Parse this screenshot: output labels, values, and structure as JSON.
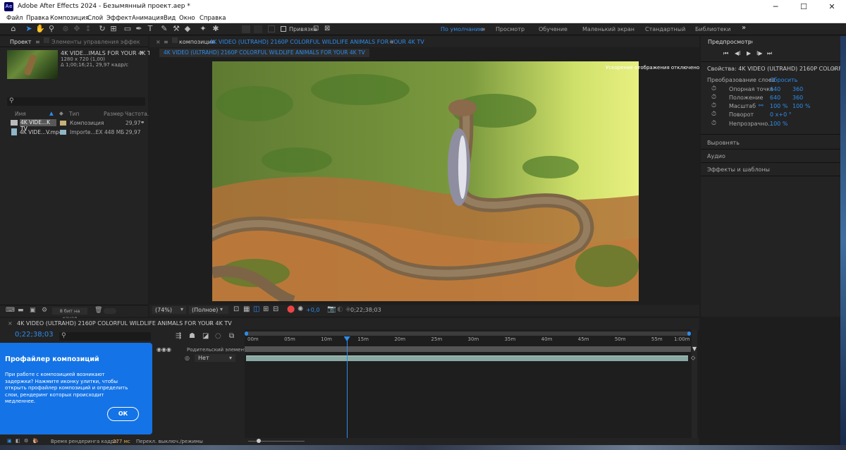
{
  "window": {
    "title": "Adobe After Effects 2024 - Безымянный проект.aep *",
    "logo": "Ae",
    "min": "─",
    "max": "☐",
    "close": "✕"
  },
  "menu": [
    "Файл",
    "Правка",
    "Композиция",
    "Слой",
    "Эффект",
    "Анимация",
    "Вид",
    "Окно",
    "Справка"
  ],
  "toolbar": {
    "snap_label": "Привязка"
  },
  "workspaces": [
    "По умолчанию",
    "Просмотр",
    "Обучение",
    "Маленький экран",
    "Стандартный",
    "Библиотеки"
  ],
  "workspace_more": "»",
  "project": {
    "tab_project": "Проект",
    "tab_effects": "Элементы управления эффек",
    "item_name": "4K VIDE...IMALS FOR YOUR 4K TV",
    "item_dims": "1280 x 720 (1,00)",
    "item_duration": "Δ 1;00;16;21, 29,97 кадр/с",
    "search_placeholder": "",
    "cols": {
      "name": "Имя",
      "type": "Тип",
      "size": "Размер",
      "fps": "Частота..."
    },
    "rows": [
      {
        "name": "4K VIDE...K TV",
        "type": "Композиция",
        "size": "",
        "fps": "29,97",
        "color": "#c7b27a"
      },
      {
        "name": "4K VIDE...V.mp4",
        "type": "Importe...EX",
        "size": "448 МБ",
        "fps": "29,97",
        "color": "#8fb7c8"
      }
    ],
    "bpc": "8 бит на канал"
  },
  "comp": {
    "tab_prefix": "композиция",
    "tab_name": "4K VIDEO (ULTRAHD) 2160P COLORFUL WILDLIFE ANIMALS FOR YOUR 4K TV",
    "subtab": "4K VIDEO (ULTRAHD) 2160P COLORFUL WILDLIFE ANIMALS FOR YOUR 4K TV",
    "overlay": "Ускорение отображения отключено",
    "zoom": "(74%)",
    "quality": "(Полное)",
    "exposure": "+0,0",
    "timecode": "0;22;38;03"
  },
  "preview": {
    "title": "Предпросмотр",
    "buttons": [
      "⏮",
      "◀I",
      "▶",
      "I▶",
      "⏭"
    ]
  },
  "properties": {
    "title": "Свойства: 4K VIDEO (ULTRAHD) 2160P COLORFUL W",
    "section": "Преобразование слоев",
    "reset": "Сбросить",
    "items": [
      {
        "label": "Опорная точка",
        "v1": "640",
        "v2": "360"
      },
      {
        "label": "Положение",
        "v1": "640",
        "v2": "360"
      },
      {
        "label": "Масштаб",
        "v1": "100 %",
        "v2": "100 %"
      },
      {
        "label": "Поворот",
        "v1": "0 x+0 °",
        "v2": ""
      },
      {
        "label": "Непрозрачно...",
        "v1": "100 %",
        "v2": ""
      }
    ],
    "sections": [
      "Выровнять",
      "Аудио",
      "Эффекты и шаблоны"
    ]
  },
  "timeline": {
    "tab": "4K VIDEO (ULTRAHD) 2160P COLORFUL WILDLIFE ANIMALS FOR YOUR 4K TV",
    "timecode": "0;22;38;03",
    "parent_col": "Родительский элемент ...",
    "parent_val": "Нет",
    "ruler": [
      "00m",
      "05m",
      "10m",
      "15m",
      "20m",
      "25m",
      "30m",
      "35m",
      "40m",
      "45m",
      "50m",
      "55m",
      "1:00m"
    ],
    "playhead_pct": 0.225
  },
  "popup": {
    "title": "Профайлер композиций",
    "body": "При работе с композицией возникают задержки? Нажмите иконку улитки, чтобы открыть профайлер композиций и определить слои, рендеринг которых происходит медленнее.",
    "ok": "ОК"
  },
  "status": {
    "render_label": "Время рендеринга кадра:",
    "render_value": "277 мс",
    "toggle": "Перекл. выключ./режимы"
  }
}
